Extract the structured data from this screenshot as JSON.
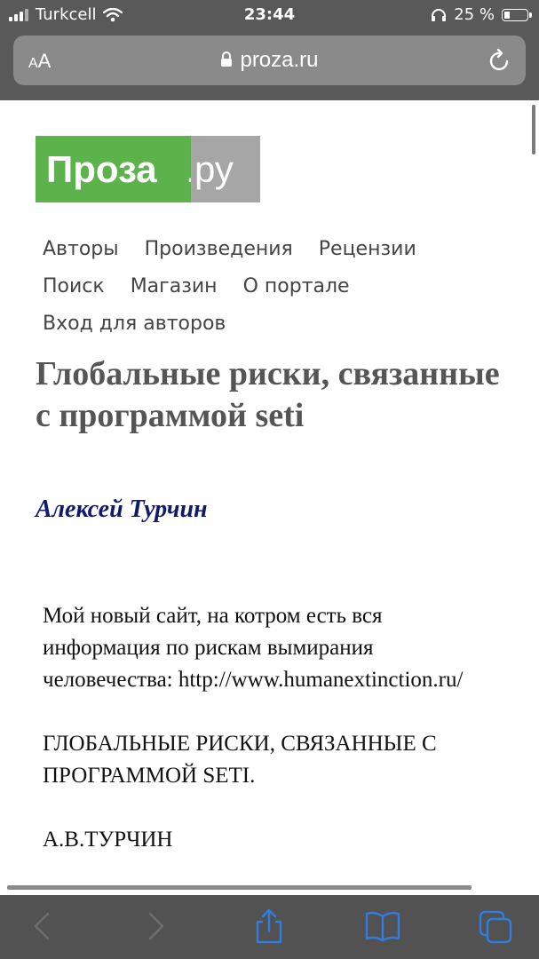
{
  "status_bar": {
    "carrier": "Turkcell",
    "time": "23:44",
    "battery_percent": "25 %",
    "battery_level": 0.25
  },
  "browser": {
    "aa_label_small": "A",
    "aa_label_large": "A",
    "url": "proza.ru"
  },
  "site": {
    "logo_main": "Проза",
    "logo_dot": ".",
    "logo_suffix": "ру",
    "logo_colors": {
      "green": "#5cb34c",
      "gray": "#a6a6a6"
    },
    "nav": [
      "Авторы",
      "Произведения",
      "Рецензии",
      "Поиск",
      "Магазин",
      "О портале",
      "Вход для авторов"
    ]
  },
  "article": {
    "title": "Глобальные риски, связанные с программой seti",
    "author": "Алексей Турчин",
    "paragraphs": [
      "Мой новый сайт, на котром есть вся информация по рискам вымирания человечества: http://www.humanextinction.ru/",
      "ГЛОБАЛЬНЫЕ РИСКИ, СВЯЗАННЫЕ С ПРОГРАММОЙ SETI.",
      "А.В.ТУРЧИН"
    ]
  },
  "toolbar": {
    "icons": [
      "back-icon",
      "forward-icon",
      "share-icon",
      "bookmarks-icon",
      "tabs-icon"
    ]
  }
}
